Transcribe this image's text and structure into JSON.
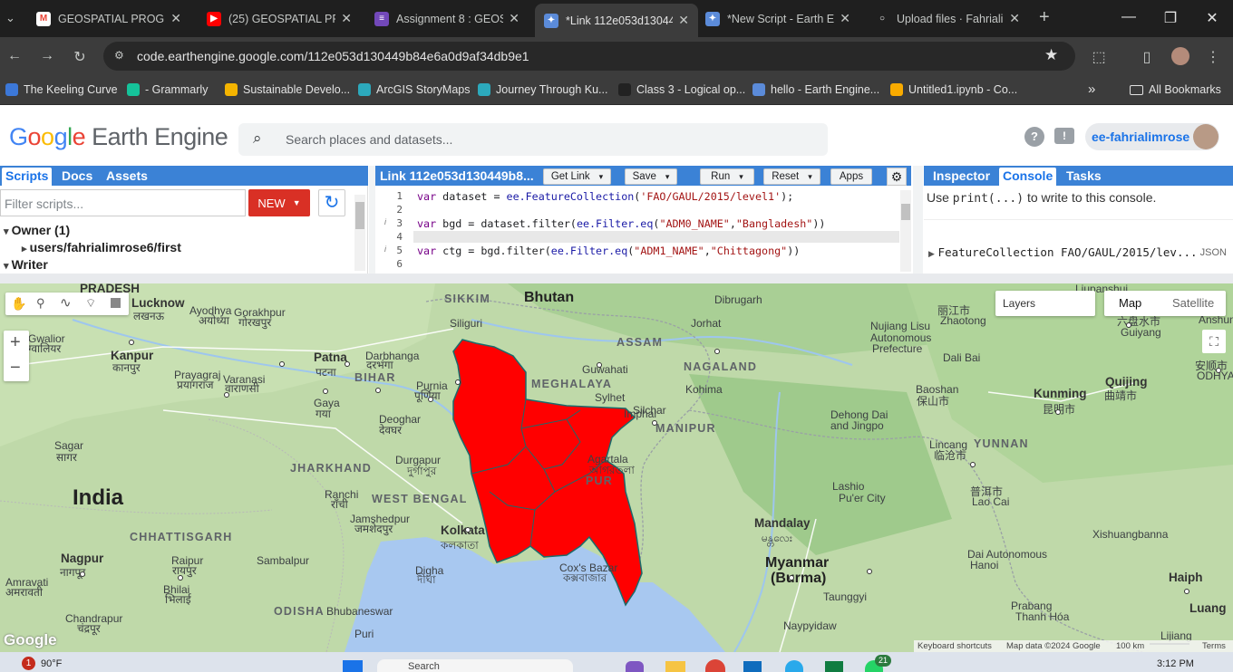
{
  "browser": {
    "tabs": [
      {
        "title": "GEOSPATIAL PROGRA",
        "icon": "gmail-icon"
      },
      {
        "title": "(25) GEOSPATIAL PRO",
        "icon": "youtube-icon"
      },
      {
        "title": "Assignment 8 : GEOS",
        "icon": "forms-icon"
      },
      {
        "title": "*Link 112e053d13044",
        "icon": "earth-engine-icon"
      },
      {
        "title": "*New Script - Earth E",
        "icon": "earth-engine-icon"
      },
      {
        "title": "Upload files · Fahrialin",
        "icon": "github-icon"
      }
    ],
    "url": "code.earthengine.google.com/112e053d130449b84e6a0d9af34db9e1",
    "bookmarks": [
      "The Keeling Curve",
      "- Grammarly",
      "Sustainable Develo...",
      "ArcGIS StoryMaps",
      "Journey Through Ku...",
      "Class 3 - Logical op...",
      "hello - Earth Engine...",
      "Untitled1.ipynb - Co..."
    ],
    "all_bookmarks": "All Bookmarks",
    "more": "»"
  },
  "gee": {
    "logo_google": "Google",
    "logo_rest": " Earth Engine",
    "search_placeholder": "Search places and datasets...",
    "user": "ee-fahrialimrose"
  },
  "left_panel": {
    "tabs": [
      "Scripts",
      "Docs",
      "Assets"
    ],
    "filter_placeholder": "Filter scripts...",
    "new_button": "NEW",
    "tree": [
      {
        "label": "Owner (1)",
        "level": 0
      },
      {
        "label": "users/fahrialimrose6/first",
        "level": 1
      },
      {
        "label": "Writer",
        "level": 0
      }
    ]
  },
  "editor": {
    "title": "Link 112e053d130449b8...",
    "buttons": [
      "Get Link",
      "Save",
      "Run",
      "Reset",
      "Apps"
    ],
    "lines": [
      {
        "n": "1",
        "text": "var dataset = ee.FeatureCollection('FAO/GAUL/2015/level1');"
      },
      {
        "n": "2",
        "text": ""
      },
      {
        "n": "3",
        "text": "var bgd = dataset.filter(ee.Filter.eq(\"ADM0_NAME\",\"Bangladesh\"))"
      },
      {
        "n": "4",
        "text": ""
      },
      {
        "n": "5",
        "text": "var ctg = bgd.filter(ee.Filter.eq(\"ADM1_NAME\",\"Chittagong\"))"
      },
      {
        "n": "6",
        "text": ""
      }
    ]
  },
  "right_panel": {
    "tabs": [
      "Inspector",
      "Console",
      "Tasks"
    ],
    "hint_pre": "Use ",
    "hint_code": "print(...)",
    "hint_post": " to write to this console.",
    "output": "FeatureCollection FAO/GAUL/2015/lev...",
    "output_tag": "JSON"
  },
  "map": {
    "layers": "Layers",
    "map_btn": "Map",
    "satellite_btn": "Satellite",
    "zoom_in": "+",
    "zoom_out": "−",
    "footer": [
      "Keyboard shortcuts",
      "Map data ©2024 Google",
      "100 km",
      "Terms"
    ],
    "google": "Google",
    "labels": [
      {
        "t": "PRADESH"
      },
      {
        "t": "Lucknow"
      },
      {
        "t": "लखनऊ"
      },
      {
        "t": "Ayodhya"
      },
      {
        "t": "अयोध्या"
      },
      {
        "t": "Gorakhpur"
      },
      {
        "t": "गोरखपुर"
      },
      {
        "t": "SIKKIM"
      },
      {
        "t": "Bhutan"
      },
      {
        "t": "Dibrugarh"
      },
      {
        "t": "Siliguri"
      },
      {
        "t": "ASSAM"
      },
      {
        "t": "Jorhat"
      },
      {
        "t": "Gwalior"
      },
      {
        "t": "ग्वालियर"
      },
      {
        "t": "Kanpur"
      },
      {
        "t": "कानपुर"
      },
      {
        "t": "Patna"
      },
      {
        "t": "पटना"
      },
      {
        "t": "Darbhanga"
      },
      {
        "t": "दरभंगा"
      },
      {
        "t": "BIHAR"
      },
      {
        "t": "Prayagraj"
      },
      {
        "t": "प्रयागराज"
      },
      {
        "t": "Varanasi"
      },
      {
        "t": "वाराणसी"
      },
      {
        "t": "Purnia"
      },
      {
        "t": "पूर्णिया"
      },
      {
        "t": "MEGHALAYA"
      },
      {
        "t": "Guwahati"
      },
      {
        "t": "NAGALAND"
      },
      {
        "t": "Kohima"
      },
      {
        "t": "Sylhet"
      },
      {
        "t": "Silchar"
      },
      {
        "t": "MANIPUR"
      },
      {
        "t": "Imphal"
      },
      {
        "t": "Gaya"
      },
      {
        "t": "गया"
      },
      {
        "t": "Deoghar"
      },
      {
        "t": "देवघर"
      },
      {
        "t": "Sagar"
      },
      {
        "t": "सागर"
      },
      {
        "t": "JHARKHAND"
      },
      {
        "t": "Durgapur"
      },
      {
        "t": "দুর্গাপুর"
      },
      {
        "t": "Agartala"
      },
      {
        "t": "আগরতলা"
      },
      {
        "t": "PUR"
      },
      {
        "t": "India"
      },
      {
        "t": "Ranchi"
      },
      {
        "t": "राँची"
      },
      {
        "t": "WEST BENGAL"
      },
      {
        "t": "Jamshedpur"
      },
      {
        "t": "जमशेदपुर"
      },
      {
        "t": "Kolkata"
      },
      {
        "t": "কলকাতা"
      },
      {
        "t": "CHHATTISGARH"
      },
      {
        "t": "Nagpur"
      },
      {
        "t": "नागपूर"
      },
      {
        "t": "Raipur"
      },
      {
        "t": "रायपुर"
      },
      {
        "t": "Sambalpur"
      },
      {
        "t": "Amravati"
      },
      {
        "t": "अमरावती"
      },
      {
        "t": "Bhilai"
      },
      {
        "t": "भिलाई"
      },
      {
        "t": "Digha"
      },
      {
        "t": "দীঘা"
      },
      {
        "t": "Cox's Bazar"
      },
      {
        "t": "কক্সবাজার"
      },
      {
        "t": "Chandrapur"
      },
      {
        "t": "चंद्रपूर"
      },
      {
        "t": "ODISHA"
      },
      {
        "t": "Bhubaneswar"
      },
      {
        "t": "Puri"
      },
      {
        "t": "Mandalay"
      },
      {
        "t": "မန္တလေး"
      },
      {
        "t": "Myanmar"
      },
      {
        "t": "(Burma)"
      },
      {
        "t": "Taunggyi"
      },
      {
        "t": "Naypyidaw"
      },
      {
        "t": "YUNNAN"
      },
      {
        "t": "Kunming"
      },
      {
        "t": "昆明市"
      },
      {
        "t": "Quijing"
      },
      {
        "t": "曲靖市"
      },
      {
        "t": "Baoshan"
      },
      {
        "t": "保山市"
      },
      {
        "t": "Nujiang Lisu"
      },
      {
        "t": "Autonomous"
      },
      {
        "t": "Prefecture"
      },
      {
        "t": "Dali Bai"
      },
      {
        "t": "Dehong Dai"
      },
      {
        "t": "and Jingpo"
      },
      {
        "t": "Lincang"
      },
      {
        "t": "临沧市"
      },
      {
        "t": "Lashio"
      },
      {
        "t": "Pu'er City"
      },
      {
        "t": "普洱市"
      },
      {
        "t": "Lao Cai"
      },
      {
        "t": "Xishuangbanna"
      },
      {
        "t": "Dai Autonomous"
      },
      {
        "t": "Hanoi"
      },
      {
        "t": "Haiph"
      },
      {
        "t": "Luang"
      },
      {
        "t": "Prabang"
      },
      {
        "t": "Thanh Hóa"
      },
      {
        "t": "Lijiang"
      },
      {
        "t": "丽江市"
      },
      {
        "t": "Zhaotong"
      },
      {
        "t": "Liupanshui"
      },
      {
        "t": "六盘水市"
      },
      {
        "t": "Guiyang"
      },
      {
        "t": "Anshun"
      },
      {
        "t": "安顺市"
      },
      {
        "t": "ODHYA"
      }
    ]
  },
  "taskbar": {
    "weather": "90°F",
    "badge": "1",
    "search": "Search",
    "time": "3:12 PM",
    "notif": "21"
  }
}
